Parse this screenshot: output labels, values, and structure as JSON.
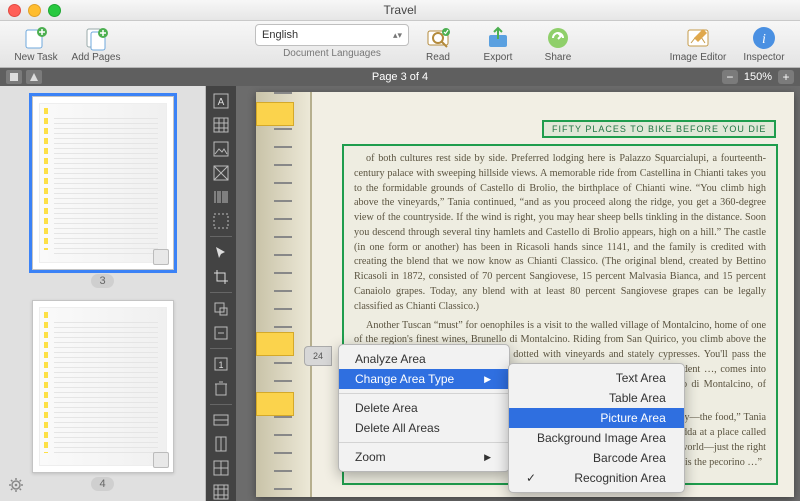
{
  "window": {
    "title": "Travel"
  },
  "toolbar": {
    "new_task": "New Task",
    "add_pages": "Add Pages",
    "read": "Read",
    "export": "Export",
    "share": "Share",
    "image_editor": "Image Editor",
    "inspector": "Inspector",
    "language": {
      "selected": "English",
      "caption": "Document Languages"
    }
  },
  "subbar": {
    "page_indicator": "Page 3 of 4",
    "zoom": "150%"
  },
  "thumbnails": [
    {
      "num": "3"
    },
    {
      "num": "4"
    }
  ],
  "ruler_label": "24",
  "scan": {
    "header": "FIFTY PLACES TO BIKE BEFORE YOU DIE",
    "p1": "of both cultures rest side by side. Preferred lodging here is Palazzo Squarcialupi, a fourteenth-century palace with sweeping hillside views. A memorable ride from Castellina in Chianti takes you to the formidable grounds of Castello di Brolio, the birthplace of Chianti wine. “You climb high above the vineyards,” Tania continued, “and as you proceed along the ridge, you get a 360-degree view of the countryside. If the wind is right, you may hear sheep bells tinkling in the distance. Soon you descend through several tiny hamlets and Castello di Brolio appears, high on a hill.” The castle (in one form or another) has been in Ricasoli hands since 1141, and the family is credited with creating the blend that we now know as Chianti Classico. (The original blend, created by Bettino Ricasoli in 1872, consisted of 70 percent Sangiovese, 15 percent Malvasia Bianca, and 15 percent Canaiolo grapes. Today, any blend with at least 80 percent Sangiovese grapes can be legally classified as Chianti Classico.)",
    "p2": "Another Tuscan “must” for oenophiles is a visit to the walled village of Montalcino, home of one of the region's finest wines, Brunello di Montalcino. Riding from San Quirico, you climb above the Val d'Orcia region, with rolling hills dotted with vineyards and stately cypresses. You'll pass the Abbazia di Sant'Antimo, an active abbey that dates …; you may hear the resident …, comes into view—a vast cape. The Brunello grape … the final product is quite Brunello di Montalcino, of serving more complex fruit,",
    "p3": "“When I've introduced … the trip that stands out for them is—not surprisingly—the food,” Tania said. “I have several farms, one is the bruschetta that's served in the town of Radda at a place called Bar Dante Alighieri Di Ferrucci Fabrizio. It has to be the best bruschetta in the world—just the right amount of garlic and salt, and the tomatoes are unlike any I've ever had. Another is the pecorino …”"
  },
  "context_menu": {
    "analyze": "Analyze Area",
    "change_type": "Change Area Type",
    "delete": "Delete Area",
    "delete_all": "Delete All Areas",
    "zoom": "Zoom",
    "submenu": {
      "text": "Text Area",
      "table": "Table Area",
      "picture": "Picture Area",
      "bg": "Background Image Area",
      "barcode": "Barcode Area",
      "recognition": "Recognition Area"
    }
  }
}
